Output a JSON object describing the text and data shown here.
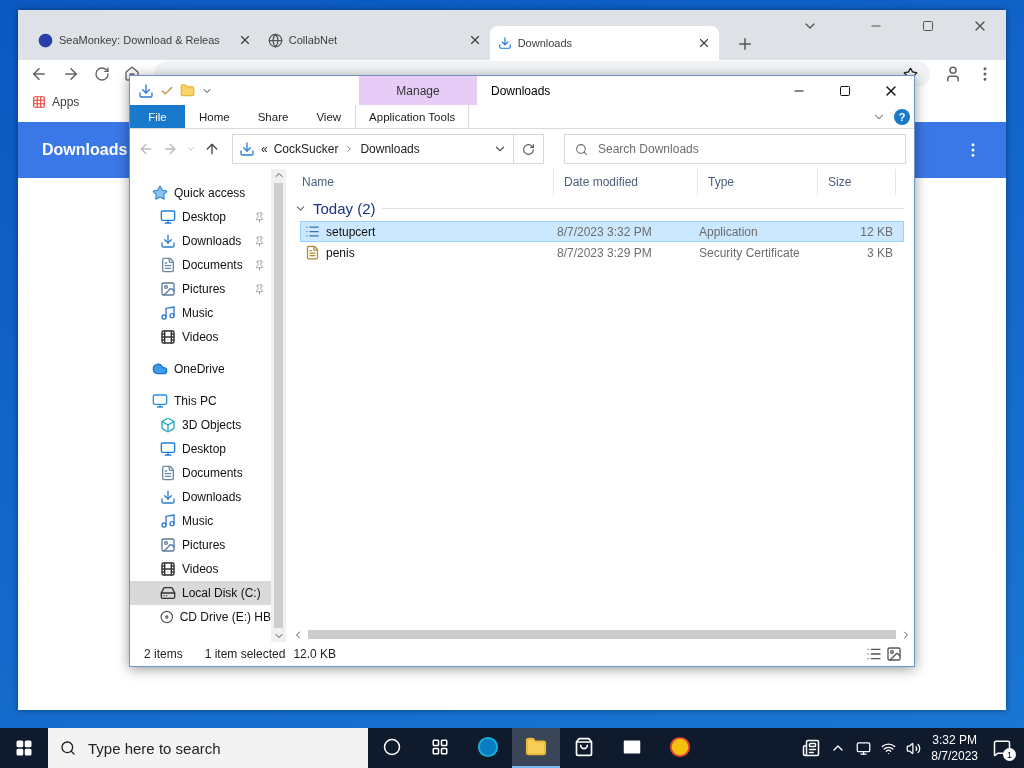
{
  "browser": {
    "tabs": [
      {
        "title": "SeaMonkey: Download & Releas",
        "kind": "seamonkey",
        "selected": false
      },
      {
        "title": "CollabNet",
        "kind": "globe",
        "selected": false
      },
      {
        "title": "Downloads",
        "kind": "download",
        "selected": true
      }
    ],
    "bookmarks": [
      "Apps"
    ],
    "page": {
      "title": "Downloads"
    }
  },
  "explorer": {
    "title": "Downloads",
    "context_header": "Manage",
    "help": "?",
    "ribbon_tabs": [
      {
        "label": "File",
        "kind": "file"
      },
      {
        "label": "Home",
        "kind": "plain"
      },
      {
        "label": "Share",
        "kind": "plain"
      },
      {
        "label": "View",
        "kind": "plain"
      },
      {
        "label": "Application Tools",
        "kind": "contextual"
      }
    ],
    "address": {
      "overflow": "«",
      "path": [
        "CockSucker",
        "Downloads"
      ]
    },
    "search": {
      "placeholder": "Search Downloads"
    },
    "nav": [
      {
        "label": "Quick access",
        "kind": "star",
        "selected": false,
        "children": [
          {
            "label": "Desktop",
            "kind": "desktop",
            "pinned": true,
            "selected": false
          },
          {
            "label": "Downloads",
            "kind": "downloads",
            "pinned": true,
            "selected": false
          },
          {
            "label": "Documents",
            "kind": "documents",
            "pinned": true,
            "selected": false
          },
          {
            "label": "Pictures",
            "kind": "pictures",
            "pinned": true,
            "selected": false
          },
          {
            "label": "Music",
            "kind": "music",
            "pinned": false,
            "selected": false
          },
          {
            "label": "Videos",
            "kind": "videos",
            "pinned": false,
            "selected": false
          }
        ]
      },
      {
        "label": "OneDrive",
        "kind": "cloud",
        "selected": false
      },
      {
        "label": "This PC",
        "kind": "pc",
        "selected": false,
        "children": [
          {
            "label": "3D Objects",
            "kind": "objects",
            "pinned": false,
            "selected": false
          },
          {
            "label": "Desktop",
            "kind": "desktop",
            "pinned": false,
            "selected": false
          },
          {
            "label": "Documents",
            "kind": "documents",
            "pinned": false,
            "selected": false
          },
          {
            "label": "Downloads",
            "kind": "downloads",
            "pinned": false,
            "selected": false
          },
          {
            "label": "Music",
            "kind": "music",
            "pinned": false,
            "selected": false
          },
          {
            "label": "Pictures",
            "kind": "pictures",
            "pinned": false,
            "selected": false
          },
          {
            "label": "Videos",
            "kind": "videos",
            "pinned": false,
            "selected": false
          },
          {
            "label": "Local Disk (C:)",
            "kind": "disk",
            "pinned": false,
            "selected": true
          },
          {
            "label": "CD Drive (E:) HB",
            "kind": "cd",
            "pinned": false,
            "selected": false
          }
        ]
      }
    ],
    "columns": [
      "Name",
      "Date modified",
      "Type",
      "Size"
    ],
    "group": {
      "label": "Today (2)",
      "expanded": true
    },
    "files": [
      {
        "name": "setupcert",
        "kind": "app",
        "date": "8/7/2023 3:32 PM",
        "type": "Application",
        "size": "12 KB",
        "selected": true
      },
      {
        "name": "penis",
        "kind": "cert",
        "date": "8/7/2023 3:29 PM",
        "type": "Security Certificate",
        "size": "3 KB",
        "selected": false
      }
    ],
    "status": {
      "count": "2 items",
      "selection": "1 item selected",
      "size": "12.0 KB"
    }
  },
  "taskbar": {
    "search": {
      "placeholder": "Type here to search"
    },
    "apps": [
      {
        "kind": "cortana",
        "active": false
      },
      {
        "kind": "taskview",
        "active": false
      },
      {
        "kind": "edge",
        "active": false
      },
      {
        "kind": "explorer",
        "active": true
      },
      {
        "kind": "store",
        "active": false
      },
      {
        "kind": "mail",
        "active": false
      },
      {
        "kind": "chrome",
        "active": false
      }
    ],
    "time": "3:32 PM",
    "date": "8/7/2023",
    "notifications": "1"
  }
}
